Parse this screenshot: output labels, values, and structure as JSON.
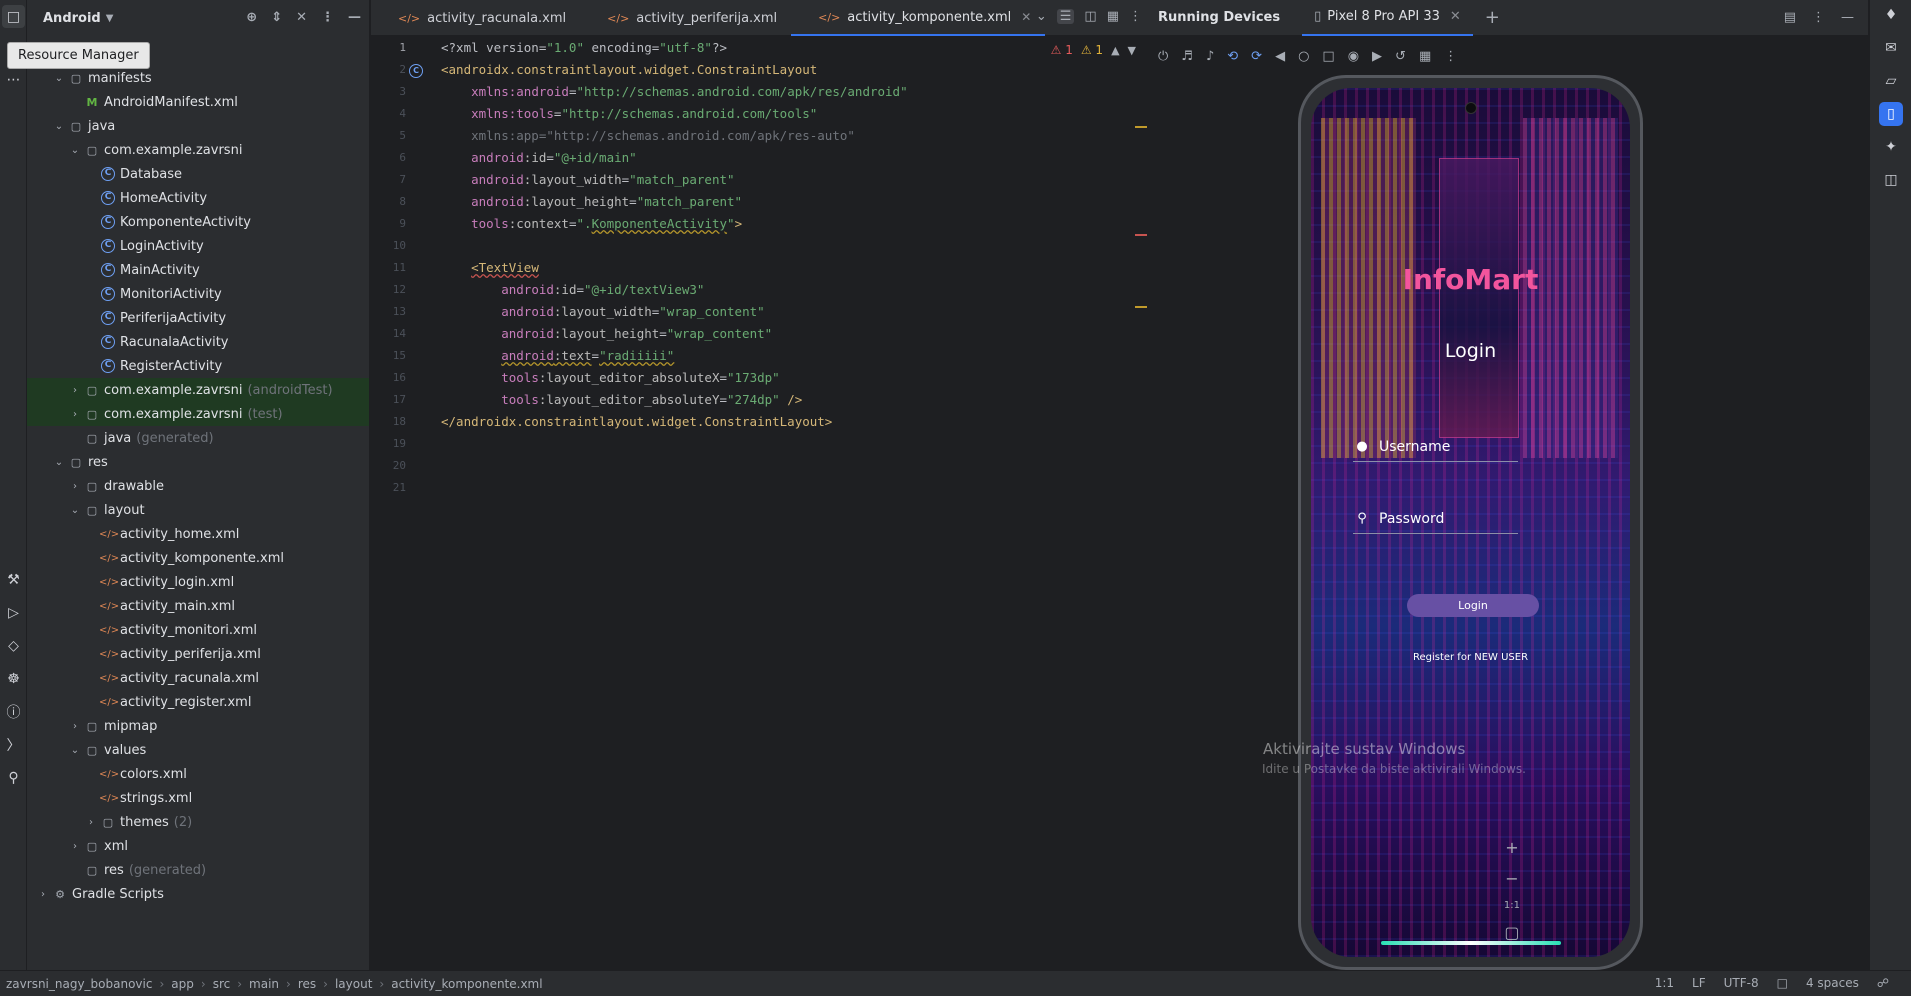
{
  "tooltip": "Resource Manager",
  "project": {
    "title": "Android",
    "tree": [
      {
        "depth": 1,
        "arrow": "v",
        "icon": "folder",
        "label": "manifests"
      },
      {
        "depth": 2,
        "arrow": "",
        "icon": "manifest",
        "label": "AndroidManifest.xml"
      },
      {
        "depth": 1,
        "arrow": "v",
        "icon": "folder",
        "label": "java"
      },
      {
        "depth": 2,
        "arrow": "v",
        "icon": "folder",
        "label": "com.example.zavrsni"
      },
      {
        "depth": 3,
        "arrow": "",
        "icon": "class",
        "label": "Database"
      },
      {
        "depth": 3,
        "arrow": "",
        "icon": "class",
        "label": "HomeActivity"
      },
      {
        "depth": 3,
        "arrow": "",
        "icon": "class",
        "label": "KomponenteActivity"
      },
      {
        "depth": 3,
        "arrow": "",
        "icon": "class",
        "label": "LoginActivity"
      },
      {
        "depth": 3,
        "arrow": "",
        "icon": "class",
        "label": "MainActivity"
      },
      {
        "depth": 3,
        "arrow": "",
        "icon": "class",
        "label": "MonitoriActivity"
      },
      {
        "depth": 3,
        "arrow": "",
        "icon": "class",
        "label": "PeriferijaActivity"
      },
      {
        "depth": 3,
        "arrow": "",
        "icon": "class",
        "label": "RacunalaActivity"
      },
      {
        "depth": 3,
        "arrow": "",
        "icon": "class",
        "label": "RegisterActivity"
      },
      {
        "depth": 2,
        "arrow": ">",
        "icon": "folder",
        "label": "com.example.zavrsni",
        "suffix": "(androidTest)",
        "hl": true
      },
      {
        "depth": 2,
        "arrow": ">",
        "icon": "folder",
        "label": "com.example.zavrsni",
        "suffix": "(test)",
        "hl": true
      },
      {
        "depth": 2,
        "arrow": "",
        "icon": "folder",
        "label": "java",
        "suffix": "(generated)"
      },
      {
        "depth": 1,
        "arrow": "v",
        "icon": "folder",
        "label": "res"
      },
      {
        "depth": 2,
        "arrow": ">",
        "icon": "folder",
        "label": "drawable"
      },
      {
        "depth": 2,
        "arrow": "v",
        "icon": "folder",
        "label": "layout"
      },
      {
        "depth": 3,
        "arrow": "",
        "icon": "xml",
        "label": "activity_home.xml"
      },
      {
        "depth": 3,
        "arrow": "",
        "icon": "xml",
        "label": "activity_komponente.xml"
      },
      {
        "depth": 3,
        "arrow": "",
        "icon": "xml",
        "label": "activity_login.xml"
      },
      {
        "depth": 3,
        "arrow": "",
        "icon": "xml",
        "label": "activity_main.xml"
      },
      {
        "depth": 3,
        "arrow": "",
        "icon": "xml",
        "label": "activity_monitori.xml"
      },
      {
        "depth": 3,
        "arrow": "",
        "icon": "xml",
        "label": "activity_periferija.xml"
      },
      {
        "depth": 3,
        "arrow": "",
        "icon": "xml",
        "label": "activity_racunala.xml"
      },
      {
        "depth": 3,
        "arrow": "",
        "icon": "xml",
        "label": "activity_register.xml"
      },
      {
        "depth": 2,
        "arrow": ">",
        "icon": "folder",
        "label": "mipmap"
      },
      {
        "depth": 2,
        "arrow": "v",
        "icon": "folder",
        "label": "values"
      },
      {
        "depth": 3,
        "arrow": "",
        "icon": "xml",
        "label": "colors.xml"
      },
      {
        "depth": 3,
        "arrow": "",
        "icon": "xml",
        "label": "strings.xml"
      },
      {
        "depth": 3,
        "arrow": ">",
        "icon": "folder",
        "label": "themes",
        "suffix": "(2)"
      },
      {
        "depth": 2,
        "arrow": ">",
        "icon": "folder",
        "label": "xml"
      },
      {
        "depth": 2,
        "arrow": "",
        "icon": "folder",
        "label": "res",
        "suffix": "(generated)"
      },
      {
        "depth": 0,
        "arrow": ">",
        "icon": "gradle",
        "label": "Gradle Scripts"
      }
    ]
  },
  "editor": {
    "tabs": [
      {
        "label": "activity_racunala.xml",
        "active": false
      },
      {
        "label": "activity_periferija.xml",
        "active": false
      },
      {
        "label": "activity_komponente.xml",
        "active": true
      }
    ],
    "inspections": {
      "errors": "1",
      "warnings": "1"
    },
    "lines": [
      [
        [
          "def",
          "<?xml version="
        ],
        [
          "str",
          "\"1.0\""
        ],
        [
          "def",
          " encoding="
        ],
        [
          "str",
          "\"utf-8\""
        ],
        [
          "def",
          "?>"
        ]
      ],
      [
        [
          "tag",
          "<androidx.constraintlayout.widget.ConstraintLayout"
        ]
      ],
      [
        [
          "def",
          "    "
        ],
        [
          "ns",
          "xmlns:android"
        ],
        [
          "def",
          "="
        ],
        [
          "str",
          "\"http://schemas.android.com/apk/res/android\""
        ]
      ],
      [
        [
          "def",
          "    "
        ],
        [
          "ns",
          "xmlns:tools"
        ],
        [
          "def",
          "="
        ],
        [
          "str",
          "\"http://schemas.android.com/tools\""
        ]
      ],
      [
        [
          "dim",
          "    xmlns:app=\"http://schemas.android.com/apk/res-auto\""
        ]
      ],
      [
        [
          "def",
          "    "
        ],
        [
          "ns",
          "android"
        ],
        [
          "attr",
          ":id"
        ],
        [
          "def",
          "="
        ],
        [
          "str",
          "\"@+id/main\""
        ]
      ],
      [
        [
          "def",
          "    "
        ],
        [
          "ns",
          "android"
        ],
        [
          "attr",
          ":layout_width"
        ],
        [
          "def",
          "="
        ],
        [
          "str",
          "\"match_parent\""
        ]
      ],
      [
        [
          "def",
          "    "
        ],
        [
          "ns",
          "android"
        ],
        [
          "attr",
          ":layout_height"
        ],
        [
          "def",
          "="
        ],
        [
          "str",
          "\"match_parent\""
        ]
      ],
      [
        [
          "def",
          "    "
        ],
        [
          "ns",
          "tools"
        ],
        [
          "attr",
          ":context"
        ],
        [
          "def",
          "="
        ],
        [
          "str",
          "\"."
        ],
        [
          "strw",
          "KomponenteActivity"
        ],
        [
          "str",
          "\""
        ],
        [
          "tag",
          ">"
        ]
      ],
      [
        [
          "def",
          ""
        ]
      ],
      [
        [
          "def",
          "    "
        ],
        [
          "tagerr",
          "<TextView"
        ]
      ],
      [
        [
          "def",
          "        "
        ],
        [
          "ns",
          "android"
        ],
        [
          "attr",
          ":id"
        ],
        [
          "def",
          "="
        ],
        [
          "str",
          "\"@+id/textView3\""
        ]
      ],
      [
        [
          "def",
          "        "
        ],
        [
          "ns",
          "android"
        ],
        [
          "attr",
          ":layout_width"
        ],
        [
          "def",
          "="
        ],
        [
          "str",
          "\"wrap_content\""
        ]
      ],
      [
        [
          "def",
          "        "
        ],
        [
          "ns",
          "android"
        ],
        [
          "attr",
          ":layout_height"
        ],
        [
          "def",
          "="
        ],
        [
          "str",
          "\"wrap_content\""
        ]
      ],
      [
        [
          "def",
          "        "
        ],
        [
          "nsw",
          "android"
        ],
        [
          "attrw",
          ":text"
        ],
        [
          "def",
          "="
        ],
        [
          "strw",
          "\"radiiiii\""
        ]
      ],
      [
        [
          "def",
          "        "
        ],
        [
          "ns",
          "tools"
        ],
        [
          "attr",
          ":layout_editor_absoluteX"
        ],
        [
          "def",
          "="
        ],
        [
          "str",
          "\"173dp\""
        ]
      ],
      [
        [
          "def",
          "        "
        ],
        [
          "ns",
          "tools"
        ],
        [
          "attr",
          ":layout_editor_absoluteY"
        ],
        [
          "def",
          "="
        ],
        [
          "str",
          "\"274dp\""
        ],
        [
          "tag",
          " />"
        ]
      ],
      [
        [
          "tag",
          "</androidx.constraintlayout.widget.ConstraintLayout>"
        ]
      ],
      [
        [
          "def",
          ""
        ]
      ],
      [
        [
          "def",
          ""
        ]
      ],
      [
        [
          "def",
          ""
        ]
      ]
    ]
  },
  "running_devices": {
    "title": "Running Devices",
    "device_tab": "Pixel 8 Pro API 33",
    "app": {
      "title": "InfoMart",
      "heading": "Login",
      "username_hint": "Username",
      "password_hint": "Password",
      "login_button": "Login",
      "register_link": "Register for NEW USER"
    },
    "zoom_reset": "1:1"
  },
  "watermark": {
    "line1": "Aktivirajte sustav Windows",
    "line2": "Idite u Postavke da biste aktivirali Windows."
  },
  "status_bar": {
    "breadcrumb": [
      "zavrsni_nagy_bobanovic",
      "app",
      "src",
      "main",
      "res",
      "layout",
      "activity_komponente.xml"
    ],
    "position": "1:1",
    "line_sep": "LF",
    "encoding": "UTF-8",
    "indent": "4 spaces"
  },
  "colors": {
    "accent": "#3574f0",
    "app_title": "#f2559d",
    "login_button": "#6750a4"
  }
}
